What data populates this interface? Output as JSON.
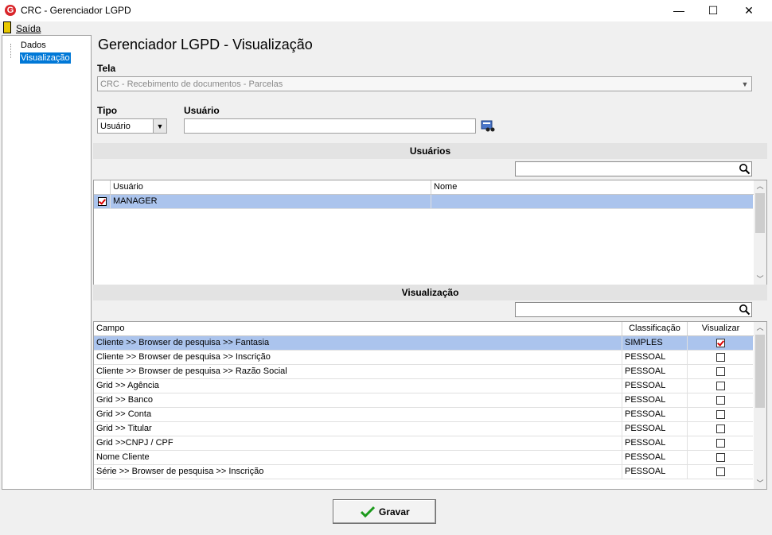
{
  "window": {
    "title": "CRC - Gerenciador LGPD",
    "app_icon_letter": "G",
    "minimize": "—",
    "maximize": "☐",
    "close": "✕"
  },
  "menu": {
    "exit_label": "Saída"
  },
  "tree": {
    "items": [
      "Dados",
      "Visualização"
    ],
    "selected": "Visualização"
  },
  "header": {
    "title": "Gerenciador LGPD - Visualização"
  },
  "form": {
    "tela_label": "Tela",
    "tela_value": "CRC - Recebimento de documentos - Parcelas",
    "tipo_label": "Tipo",
    "tipo_value": "Usuário",
    "usuario_label": "Usuário",
    "usuario_value": ""
  },
  "users_section": {
    "title": "Usuários",
    "columns": [
      "Usuário",
      "Nome"
    ],
    "rows": [
      {
        "checked": true,
        "usuario": "MANAGER",
        "nome": ""
      }
    ]
  },
  "view_section": {
    "title": "Visualização",
    "columns": [
      "Campo",
      "Classificação",
      "Visualizar"
    ],
    "rows": [
      {
        "campo": "Cliente >> Browser de pesquisa >> Fantasia",
        "classificacao": "SIMPLES",
        "visualizar": true
      },
      {
        "campo": "Cliente >> Browser de pesquisa >> Inscrição",
        "classificacao": "PESSOAL",
        "visualizar": false
      },
      {
        "campo": "Cliente >> Browser de pesquisa >> Razão Social",
        "classificacao": "PESSOAL",
        "visualizar": false
      },
      {
        "campo": "Grid >> Agência",
        "classificacao": "PESSOAL",
        "visualizar": false
      },
      {
        "campo": "Grid >> Banco",
        "classificacao": "PESSOAL",
        "visualizar": false
      },
      {
        "campo": "Grid >> Conta",
        "classificacao": "PESSOAL",
        "visualizar": false
      },
      {
        "campo": "Grid >> Titular",
        "classificacao": "PESSOAL",
        "visualizar": false
      },
      {
        "campo": "Grid >>CNPJ / CPF",
        "classificacao": "PESSOAL",
        "visualizar": false
      },
      {
        "campo": "Nome Cliente",
        "classificacao": "PESSOAL",
        "visualizar": false
      },
      {
        "campo": "Série >> Browser de pesquisa >> Inscrição",
        "classificacao": "PESSOAL",
        "visualizar": false
      }
    ]
  },
  "footer": {
    "save_label": "Gravar"
  }
}
